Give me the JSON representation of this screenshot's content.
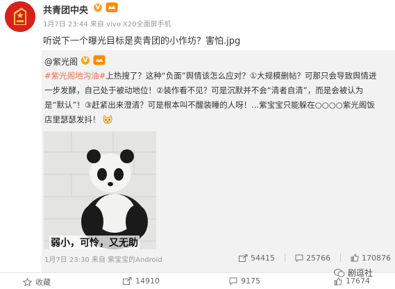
{
  "post": {
    "author": "共青团中央",
    "verified_mark": "V",
    "meta": "1月7日 23:44 来自 vivo X20全面屏手机",
    "text": "听说下一个曝光目标是卖青团的小作坊？害怕.jpg"
  },
  "repost": {
    "author": "@紫光阁",
    "verified_mark": "V",
    "body": {
      "hashtag": "#紫光阁地沟油#",
      "line1_rest": "上热搜了？这种“负面”舆情该怎么应对？①大规模删帖？可那只会导致舆情进",
      "line2": "一步发酵，自己处于被动地位！②装作看不见？可是沉默并不会“清者自清”，而是会被认为",
      "line3": "是“默认”！③赶紧出来澄清？可是根本叫不醒装睡的人呀！...紫宝宝只能躲在○○○○紫光阁饭",
      "line4": "店里瑟瑟发抖！"
    },
    "image_caption": "弱小，可怜，又无助",
    "meta": "1月7日 23:30 来自 紫宝宝的Android",
    "actions": {
      "share_count": "54415",
      "comment_count": "25766",
      "like_count": "170876"
    }
  },
  "bottom_bar": {
    "favorite_label": "收藏",
    "share_count": "14910",
    "comment_count": "9175",
    "like_count": "17674"
  },
  "watermark": "剧逗社",
  "colors": {
    "hashtag": "#eb7350",
    "verified": "#f6a623",
    "avatar_red": "#d8211c",
    "repost_bg": "#f2f2f2"
  }
}
